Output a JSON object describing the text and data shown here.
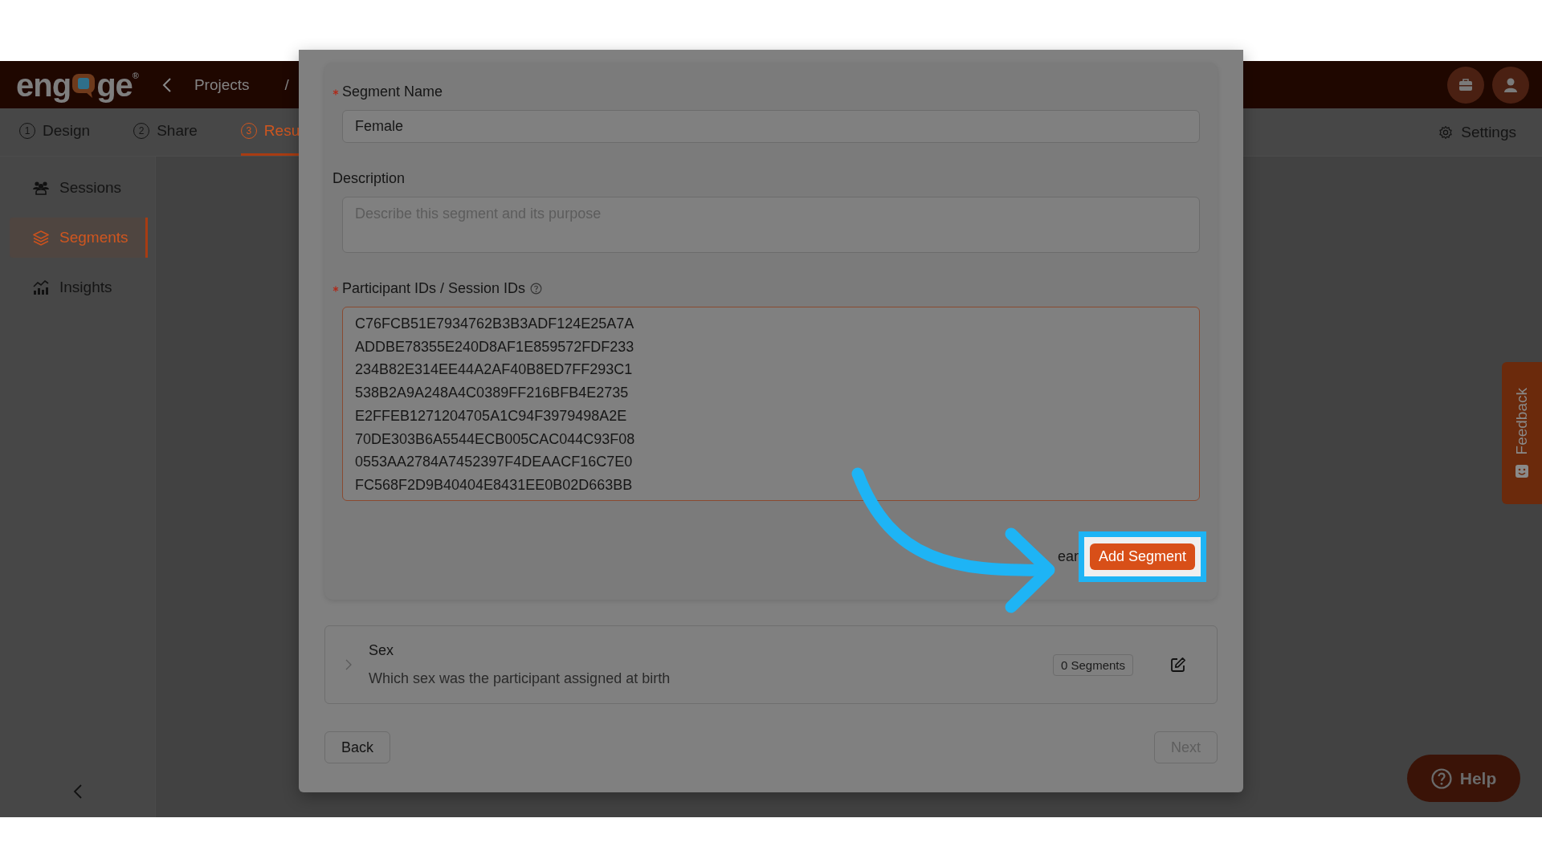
{
  "header": {
    "logo": {
      "before": "eng",
      "after": "ge",
      "mark": "®"
    },
    "breadcrumb": [
      {
        "kind": "back"
      },
      {
        "kind": "link",
        "label": "Projects"
      },
      {
        "kind": "separator",
        "label": "/"
      }
    ],
    "icons": [
      {
        "kind": "toolbox"
      },
      {
        "kind": "user"
      }
    ]
  },
  "tabs": [
    {
      "number": "1",
      "label": "Design",
      "selected": false
    },
    {
      "number": "2",
      "label": "Share",
      "selected": false
    },
    {
      "number": "3",
      "label": "Resu",
      "selected": true
    }
  ],
  "settings": {
    "label": "Settings"
  },
  "sidebar": {
    "items": [
      {
        "label": "Sessions",
        "selected": false
      },
      {
        "label": "Segments",
        "selected": true
      },
      {
        "label": "Insights",
        "selected": false
      }
    ]
  },
  "modal": {
    "segment_name": {
      "label": "Segment Name",
      "required": true,
      "value": "Female"
    },
    "description": {
      "label": "Description",
      "required": false,
      "placeholder": "Describe this segment and its purpose"
    },
    "participant_ids": {
      "label": "Participant IDs / Session IDs",
      "required": true,
      "value": [
        "C76FCB51E7934762B3B3ADF124E25A7A",
        "ADDBE78355E240D8AF1E859572FDF233",
        "234B82E314EE44A2AF40B8ED7FF293C1",
        "538B2A9A248A4C0389FF216BFB4E2735",
        "E2FFEB1271204705A1C94F3979498A2E",
        "70DE303B6A5544ECB005CAC044C93F08",
        "0553AA2784A7452397F4DEAACF16C7E0",
        "FC568F2D9B40404E8431EE0B02D663BB"
      ]
    },
    "buttons": [
      {
        "kind": "ghost",
        "label": "ear"
      },
      {
        "kind": "primary",
        "label": "Add Segment",
        "highlighted": true
      }
    ],
    "questions": [
      {
        "title": "Sex",
        "description": "Which sex was the participant assigned at birth",
        "badge": "0 Segments"
      }
    ],
    "footer": [
      {
        "label": "Back",
        "disabled": false
      },
      {
        "label": "Next",
        "disabled": true
      }
    ]
  },
  "feedback": {
    "label": "Feedback"
  },
  "help": {
    "label": "Help"
  }
}
